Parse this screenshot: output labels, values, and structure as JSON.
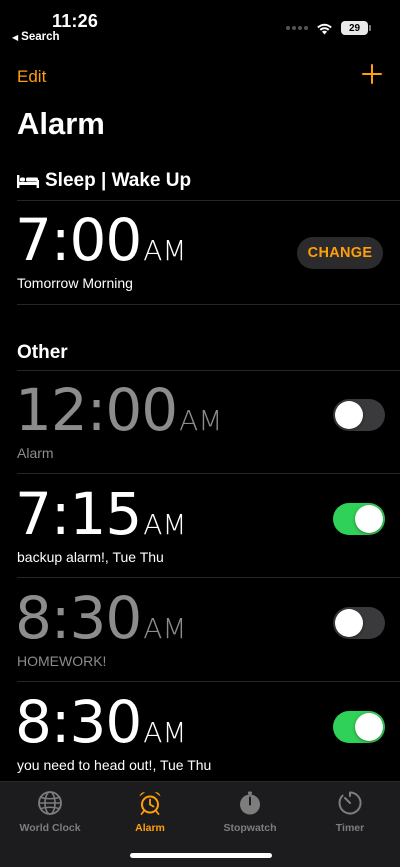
{
  "status_bar": {
    "time": "11:26",
    "back_label": "Search",
    "battery": "29"
  },
  "nav": {
    "edit_label": "Edit",
    "title": "Alarm"
  },
  "sleep": {
    "header": "Sleep | Wake Up",
    "time": "7:00",
    "ampm": "AM",
    "label": "Tomorrow Morning",
    "change_label": "CHANGE"
  },
  "other": {
    "header": "Other",
    "alarms": [
      {
        "time": "12:00",
        "ampm": "AM",
        "label": "Alarm",
        "enabled": false
      },
      {
        "time": "7:15",
        "ampm": "AM",
        "label": "backup alarm!, Tue Thu",
        "enabled": true
      },
      {
        "time": "8:30",
        "ampm": "AM",
        "label": "HOMEWORK!",
        "enabled": false
      },
      {
        "time": "8:30",
        "ampm": "AM",
        "label": "you need to head out!, Tue Thu",
        "enabled": true
      }
    ]
  },
  "tab_bar": {
    "tabs": [
      {
        "label": "World Clock",
        "icon": "globe-icon",
        "active": false
      },
      {
        "label": "Alarm",
        "icon": "alarm-clock-icon",
        "active": true
      },
      {
        "label": "Stopwatch",
        "icon": "stopwatch-icon",
        "active": false
      },
      {
        "label": "Timer",
        "icon": "timer-icon",
        "active": false
      }
    ]
  },
  "colors": {
    "accent": "#ff9f0a",
    "toggle_on": "#30d158",
    "toggle_off": "#3a3a3c",
    "background": "#000000"
  }
}
